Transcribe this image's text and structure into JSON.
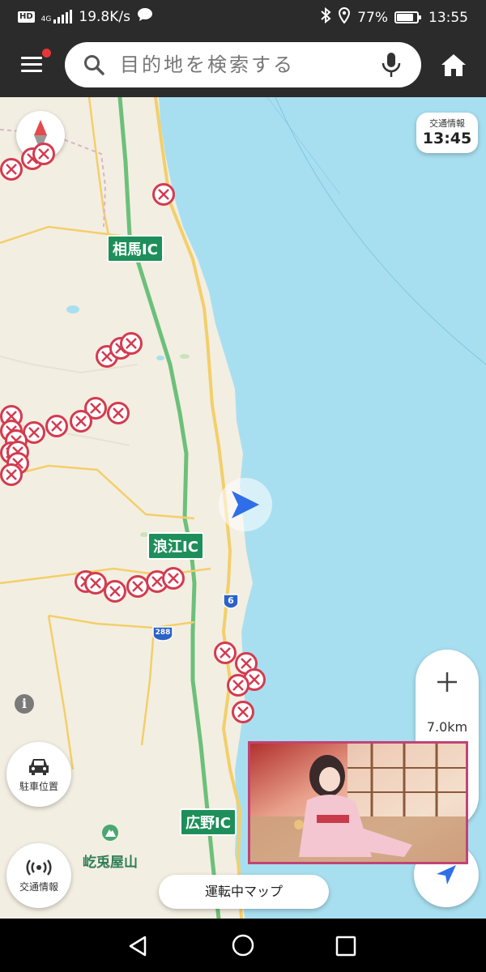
{
  "status_bar": {
    "hd": "HD",
    "network": "4G",
    "speed": "19.8K/s",
    "battery": "77%",
    "battery_level": 0.77,
    "time": "13:55",
    "icons": [
      "chat-bubble-icon",
      "bluetooth-icon",
      "location-icon",
      "battery-icon"
    ]
  },
  "header": {
    "search_placeholder": "目的地を検索する",
    "menu_has_notification": true,
    "icons": [
      "menu-icon",
      "search-icon",
      "mic-icon",
      "home-icon"
    ]
  },
  "map": {
    "traffic_label": "交通情報",
    "traffic_time": "13:45",
    "ic_labels": [
      "相馬IC",
      "浪江IC",
      "広野IC"
    ],
    "route_numbers": [
      "6",
      "288"
    ],
    "mountain_label": "屹兎屋山",
    "scale": "7.0km",
    "parking_label": "駐車位置",
    "traffic_info_label": "交通情報",
    "drive_map_label": "運転中マップ",
    "colors": {
      "land": "#f3eee2",
      "sea": "#a8dff0",
      "expressway": "#6cc07a",
      "road": "#f3cf6a",
      "closure": "#d43b4f",
      "accent_blue": "#2f6ee8",
      "ic_green": "#1e8f5a"
    }
  },
  "nav_bar": {
    "icons": [
      "back-icon",
      "home-circle-icon",
      "recent-apps-icon"
    ]
  }
}
